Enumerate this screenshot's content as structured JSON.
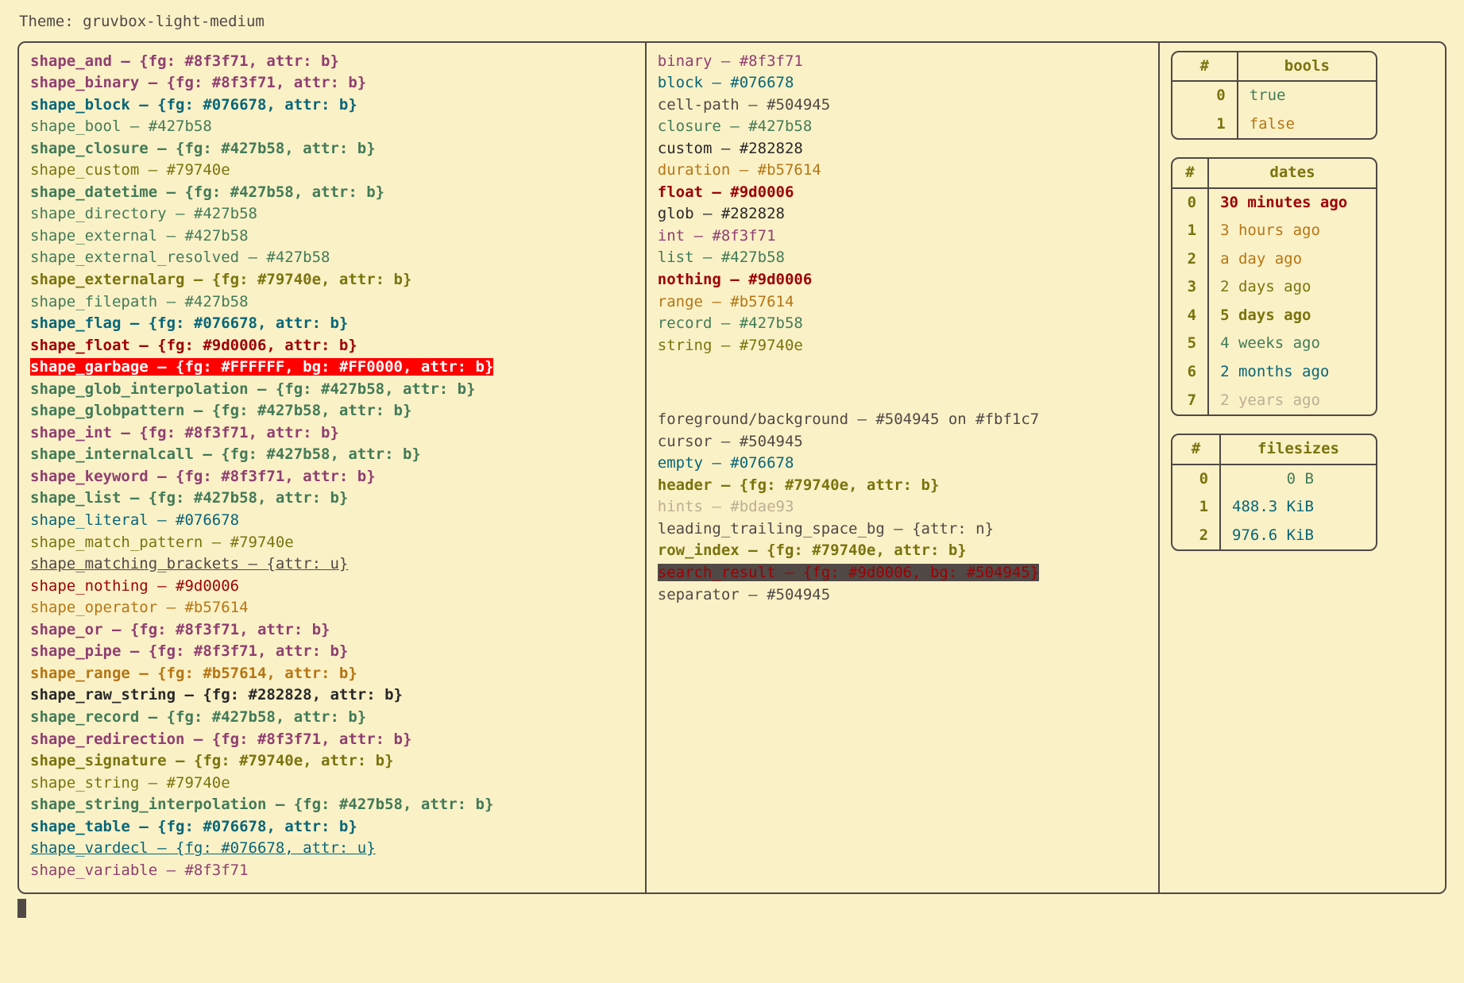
{
  "title": "Theme: gruvbox-light-medium",
  "dash": " – ",
  "colors": {
    "purple": "#8f3f71",
    "aqua": "#427b58",
    "blue": "#076678",
    "yellow": "#79740e",
    "red": "#9d0006",
    "orange": "#b57614",
    "dark": "#282828",
    "fg": "#504945",
    "gray": "#bdae93"
  },
  "shapes": [
    {
      "name": "shape_and",
      "val": "{fg: #8f3f71, attr: b}",
      "c": "purple",
      "b": true
    },
    {
      "name": "shape_binary",
      "val": "{fg: #8f3f71, attr: b}",
      "c": "purple",
      "b": true
    },
    {
      "name": "shape_block",
      "val": "{fg: #076678, attr: b}",
      "c": "blue",
      "b": true
    },
    {
      "name": "shape_bool",
      "val": "#427b58",
      "c": "aqua"
    },
    {
      "name": "shape_closure",
      "val": "{fg: #427b58, attr: b}",
      "c": "aqua",
      "b": true
    },
    {
      "name": "shape_custom",
      "val": "#79740e",
      "c": "yellow"
    },
    {
      "name": "shape_datetime",
      "val": "{fg: #427b58, attr: b}",
      "c": "aqua",
      "b": true
    },
    {
      "name": "shape_directory",
      "val": "#427b58",
      "c": "aqua"
    },
    {
      "name": "shape_external",
      "val": "#427b58",
      "c": "aqua"
    },
    {
      "name": "shape_external_resolved",
      "val": "#427b58",
      "c": "aqua"
    },
    {
      "name": "shape_externalarg",
      "val": "{fg: #79740e, attr: b}",
      "c": "yellow",
      "b": true
    },
    {
      "name": "shape_filepath",
      "val": "#427b58",
      "c": "aqua"
    },
    {
      "name": "shape_flag",
      "val": "{fg: #076678, attr: b}",
      "c": "blue",
      "b": true
    },
    {
      "name": "shape_float",
      "val": "{fg: #9d0006, attr: b}",
      "c": "red",
      "b": true
    },
    {
      "name": "shape_garbage",
      "val": "{fg: #FFFFFF, bg: #FF0000, attr: b}",
      "c": "garbage",
      "b": true
    },
    {
      "name": "shape_glob_interpolation",
      "val": "{fg: #427b58, attr: b}",
      "c": "aqua",
      "b": true
    },
    {
      "name": "shape_globpattern",
      "val": "{fg: #427b58, attr: b}",
      "c": "aqua",
      "b": true
    },
    {
      "name": "shape_int",
      "val": "{fg: #8f3f71, attr: b}",
      "c": "purple",
      "b": true
    },
    {
      "name": "shape_internalcall",
      "val": "{fg: #427b58, attr: b}",
      "c": "aqua",
      "b": true
    },
    {
      "name": "shape_keyword",
      "val": "{fg: #8f3f71, attr: b}",
      "c": "purple",
      "b": true
    },
    {
      "name": "shape_list",
      "val": "{fg: #427b58, attr: b}",
      "c": "aqua",
      "b": true
    },
    {
      "name": "shape_literal",
      "val": "#076678",
      "c": "blue"
    },
    {
      "name": "shape_match_pattern",
      "val": "#79740e",
      "c": "yellow"
    },
    {
      "name": "shape_matching_brackets",
      "val": "{attr: u}",
      "c": "fg",
      "u": true
    },
    {
      "name": "shape_nothing",
      "val": "#9d0006",
      "c": "red"
    },
    {
      "name": "shape_operator",
      "val": "#b57614",
      "c": "orange"
    },
    {
      "name": "shape_or",
      "val": "{fg: #8f3f71, attr: b}",
      "c": "purple",
      "b": true
    },
    {
      "name": "shape_pipe",
      "val": "{fg: #8f3f71, attr: b}",
      "c": "purple",
      "b": true
    },
    {
      "name": "shape_range",
      "val": "{fg: #b57614, attr: b}",
      "c": "orange",
      "b": true
    },
    {
      "name": "shape_raw_string",
      "val": "{fg: #282828, attr: b}",
      "c": "dark",
      "b": true
    },
    {
      "name": "shape_record",
      "val": "{fg: #427b58, attr: b}",
      "c": "aqua",
      "b": true
    },
    {
      "name": "shape_redirection",
      "val": "{fg: #8f3f71, attr: b}",
      "c": "purple",
      "b": true
    },
    {
      "name": "shape_signature",
      "val": "{fg: #79740e, attr: b}",
      "c": "yellow",
      "b": true
    },
    {
      "name": "shape_string",
      "val": "#79740e",
      "c": "yellow"
    },
    {
      "name": "shape_string_interpolation",
      "val": "{fg: #427b58, attr: b}",
      "c": "aqua",
      "b": true
    },
    {
      "name": "shape_table",
      "val": "{fg: #076678, attr: b}",
      "c": "blue",
      "b": true
    },
    {
      "name": "shape_vardecl",
      "val": "{fg: #076678, attr: u}",
      "c": "blue",
      "u": true
    },
    {
      "name": "shape_variable",
      "val": "#8f3f71",
      "c": "purple"
    }
  ],
  "types": [
    {
      "name": "binary",
      "val": "#8f3f71",
      "c": "purple"
    },
    {
      "name": "block",
      "val": "#076678",
      "c": "blue"
    },
    {
      "name": "cell-path",
      "val": "#504945",
      "c": "fg"
    },
    {
      "name": "closure",
      "val": "#427b58",
      "c": "aqua"
    },
    {
      "name": "custom",
      "val": "#282828",
      "c": "dark"
    },
    {
      "name": "duration",
      "val": "#b57614",
      "c": "orange"
    },
    {
      "name": "float",
      "val": "#9d0006",
      "c": "red",
      "b": true
    },
    {
      "name": "glob",
      "val": "#282828",
      "c": "dark"
    },
    {
      "name": "int",
      "val": "#8f3f71",
      "c": "purple"
    },
    {
      "name": "list",
      "val": "#427b58",
      "c": "aqua"
    },
    {
      "name": "nothing",
      "val": "#9d0006",
      "c": "red",
      "b": true
    },
    {
      "name": "range",
      "val": "#b57614",
      "c": "orange"
    },
    {
      "name": "record",
      "val": "#427b58",
      "c": "aqua"
    },
    {
      "name": "string",
      "val": "#79740e",
      "c": "yellow"
    }
  ],
  "misc": [
    {
      "name": "foreground/background",
      "val": "#504945 on #fbf1c7",
      "c": "fg"
    },
    {
      "name": "cursor",
      "val": "#504945",
      "c": "fg"
    },
    {
      "name": "empty",
      "val": "#076678",
      "c": "blue"
    },
    {
      "name": "header",
      "val": "{fg: #79740e, attr: b}",
      "c": "yellow",
      "b": true
    },
    {
      "name": "hints",
      "val": "#bdae93",
      "c": "gray"
    },
    {
      "name": "leading_trailing_space_bg",
      "val": "{attr: n}",
      "c": "fg"
    },
    {
      "name": "row_index",
      "val": "{fg: #79740e, attr: b}",
      "c": "yellow",
      "b": true
    },
    {
      "name": "search_result",
      "val": "{fg: #9d0006, bg: #504945}",
      "c": "search"
    },
    {
      "name": "separator",
      "val": "#504945",
      "c": "fg"
    }
  ],
  "tables": {
    "bools": {
      "header": [
        "#",
        "bools"
      ],
      "rows": [
        {
          "i": "0",
          "v": "true",
          "c": "aqua"
        },
        {
          "i": "1",
          "v": "false",
          "c": "orange"
        }
      ]
    },
    "dates": {
      "header": [
        "#",
        "dates"
      ],
      "rows": [
        {
          "i": "0",
          "v": "30 minutes ago",
          "c": "red",
          "b": true
        },
        {
          "i": "1",
          "v": "3 hours ago",
          "c": "orange"
        },
        {
          "i": "2",
          "v": "a day ago",
          "c": "orange"
        },
        {
          "i": "3",
          "v": "2 days ago",
          "c": "yellow"
        },
        {
          "i": "4",
          "v": "5 days ago",
          "c": "yellow",
          "b": true
        },
        {
          "i": "5",
          "v": "4 weeks ago",
          "c": "aqua"
        },
        {
          "i": "6",
          "v": "2 months ago",
          "c": "blue"
        },
        {
          "i": "7",
          "v": "2 years ago",
          "c": "gray"
        }
      ]
    },
    "filesizes": {
      "header": [
        "#",
        "filesizes"
      ],
      "rows": [
        {
          "i": "0",
          "v": "      0 B",
          "c": "aqua"
        },
        {
          "i": "1",
          "v": "488.3 KiB",
          "c": "blue"
        },
        {
          "i": "2",
          "v": "976.6 KiB",
          "c": "blue"
        }
      ]
    }
  }
}
